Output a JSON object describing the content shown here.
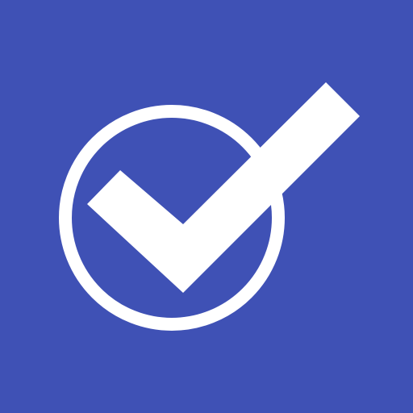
{
  "icon": {
    "name": "checkmark-in-circle-icon",
    "background_color": "#3F51B5",
    "foreground_color": "#FFFFFF"
  }
}
